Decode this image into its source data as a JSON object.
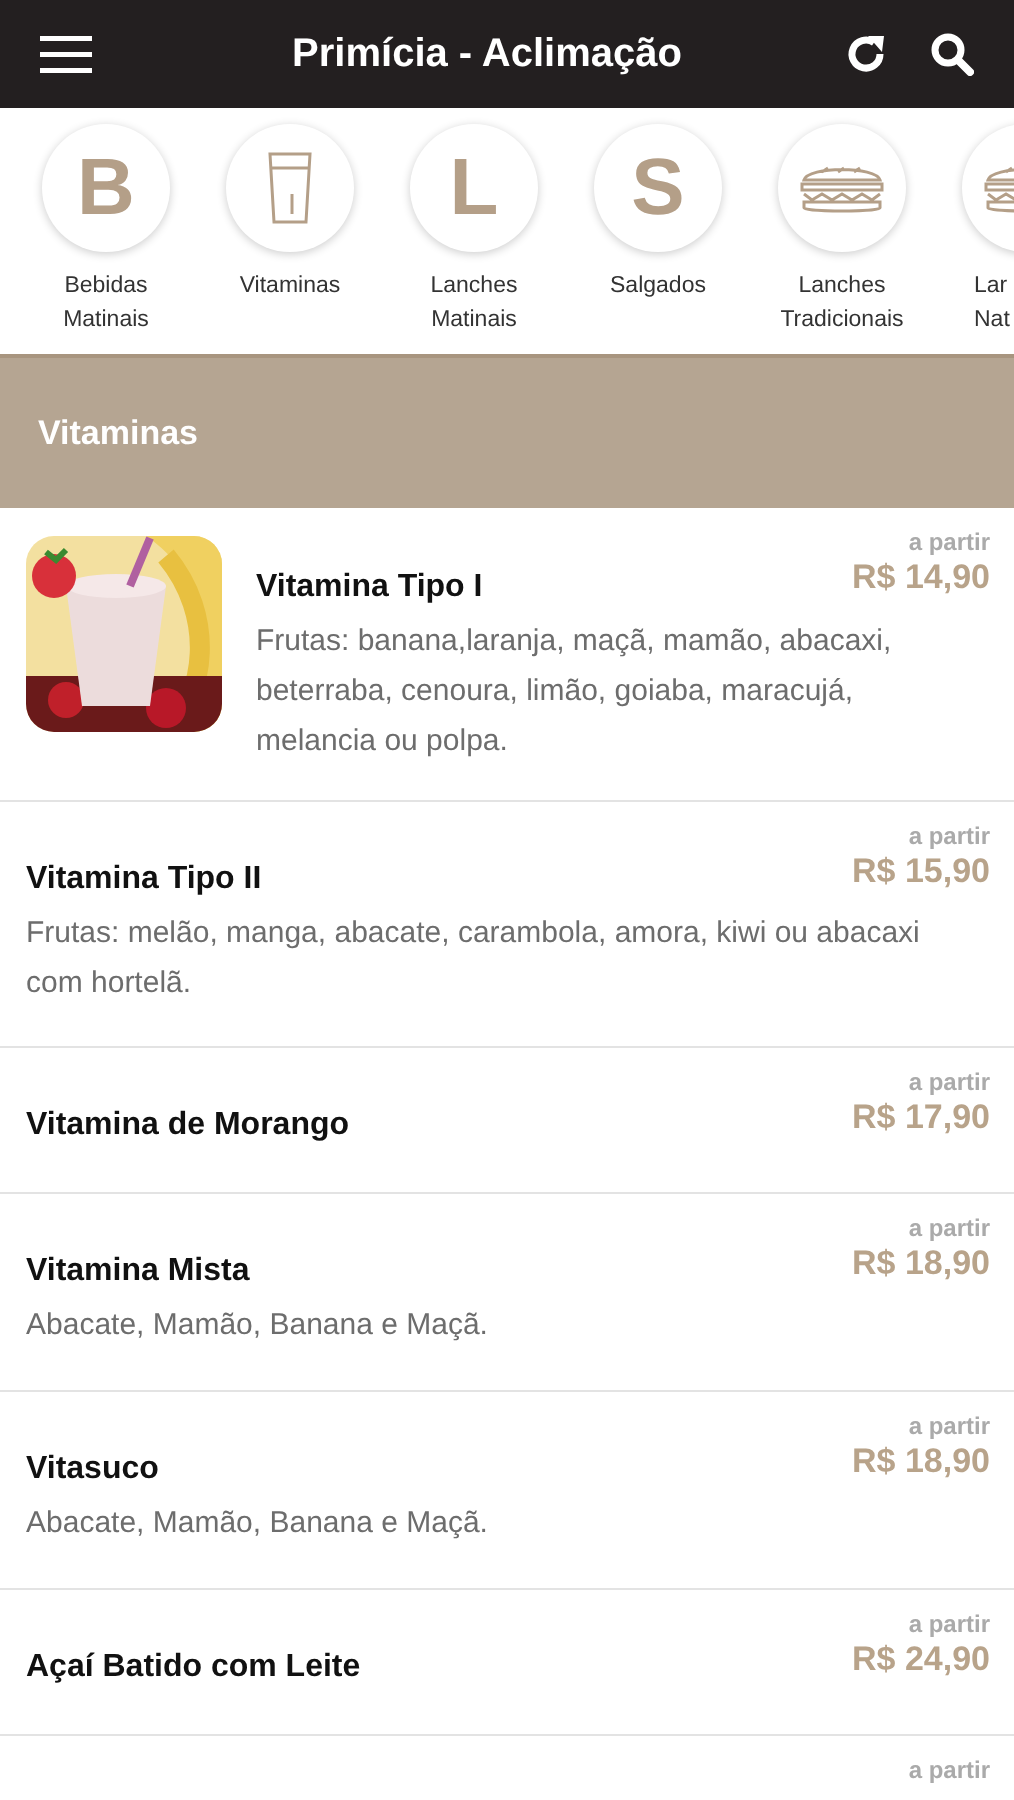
{
  "header": {
    "title": "Primícia - Aclimação"
  },
  "categories": [
    {
      "kind": "letter",
      "letter": "B",
      "lines": [
        "Bebidas",
        "Matinais"
      ]
    },
    {
      "kind": "glass",
      "lines": [
        "Vitaminas"
      ]
    },
    {
      "kind": "letter",
      "letter": "L",
      "lines": [
        "Lanches",
        "Matinais"
      ]
    },
    {
      "kind": "letter",
      "letter": "S",
      "lines": [
        "Salgados"
      ]
    },
    {
      "kind": "sandwich",
      "lines": [
        "Lanches",
        "Tradicionais"
      ]
    },
    {
      "kind": "sandwich",
      "lines": [
        "Lar",
        "Nat"
      ]
    }
  ],
  "section": {
    "title": "Vitaminas"
  },
  "items": [
    {
      "kind": "picture",
      "name": "Vitamina Tipo I",
      "description": "Frutas: banana,laranja, maçã, mamão, abacaxi, beterraba, cenoura, limão, goiaba, maracujá, melancia ou polpa.",
      "price_note": "a partir",
      "price": "R$ 14,90"
    },
    {
      "name": "Vitamina Tipo II",
      "description": "Frutas: melão, manga, abacate, carambola, amora, kiwi ou abacaxi com hortelã.",
      "price_note": "a partir",
      "price": "R$ 15,90"
    },
    {
      "name": "Vitamina de Morango",
      "price_note": "a partir",
      "price": "R$ 17,90"
    },
    {
      "name": "Vitamina Mista",
      "description": "Abacate, Mamão, Banana e Maçã.",
      "price_note": "a partir",
      "price": "R$ 18,90"
    },
    {
      "name": "Vitasuco",
      "description": "Abacate, Mamão, Banana e Maçã.",
      "price_note": "a partir",
      "price": "R$ 18,90"
    },
    {
      "name": "Açaí Batido com Leite",
      "price_note": "a partir",
      "price": "R$ 24,90"
    },
    {
      "price_note": "a partir"
    }
  ]
}
